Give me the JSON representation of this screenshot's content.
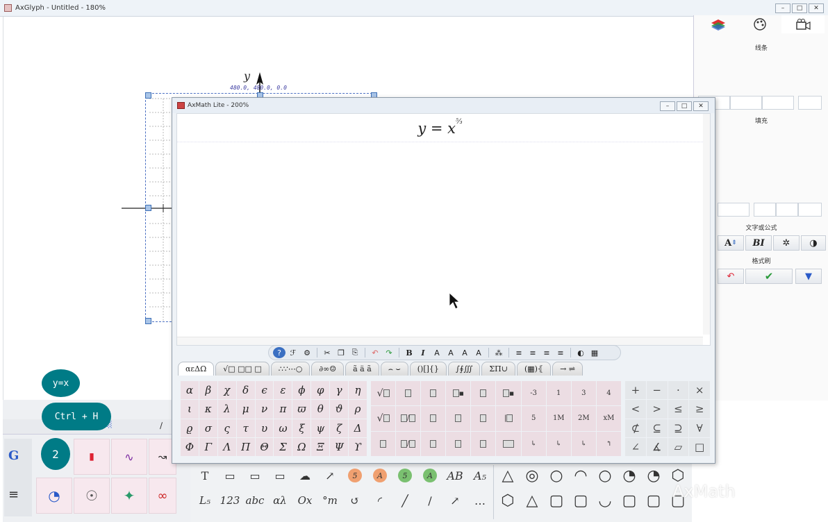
{
  "main_window": {
    "title": "AxGlyph - Untitled - 180%",
    "min": "–",
    "max": "□",
    "close": "✕"
  },
  "canvas": {
    "axis_label": "y",
    "coord_readout": "480.0, 480.0, 0.0"
  },
  "right_panel": {
    "line_label": "线条",
    "fill_label": "填充",
    "text_formula_label": "文字或公式",
    "format_brush_label": "格式刷",
    "bold_italic": "BI",
    "text_style_icon": "A"
  },
  "axmath": {
    "title": "AxMath Lite - 200%",
    "formula": "y = x",
    "formula_sup": "⁵⁄₃",
    "toolbar": [
      "?",
      "ℱ",
      "⚙",
      "✂",
      "❐",
      "⎘",
      "↶",
      "↷",
      "B",
      "I",
      "A",
      "A",
      "A",
      "A",
      "⁂",
      "≡",
      "≡",
      "≡",
      "≡",
      "◐",
      "▦"
    ],
    "tabs": [
      "αεΔΩ",
      "√□ □□ □",
      "∴∵⋯○",
      "∂∞☺",
      "ã ä ã",
      "⌢ ⌣",
      "()[]{}",
      "∫∮∭",
      "ΣΠ∪",
      "(▦)⦃",
      "→ ⇌"
    ],
    "greek": [
      "α",
      "β",
      "χ",
      "δ",
      "ϵ",
      "ε",
      "ϕ",
      "φ",
      "γ",
      "η",
      "ι",
      "κ",
      "λ",
      "μ",
      "ν",
      "π",
      "ϖ",
      "θ",
      "ϑ",
      "ρ",
      "ϱ",
      "σ",
      "ς",
      "τ",
      "υ",
      "ω",
      "ξ",
      "ψ",
      "ζ",
      "Δ",
      "Φ",
      "Γ",
      "Λ",
      "Π",
      "Θ",
      "Σ",
      "Ω",
      "Ξ",
      "Ψ",
      "ϒ"
    ],
    "templates_text": [
      "-3",
      "1",
      "3",
      "4",
      "5",
      "1M",
      "2M",
      "xM"
    ],
    "relations": [
      "+",
      "−",
      "·",
      "×",
      "<",
      ">",
      "≤",
      "≥",
      "⊄",
      "⊆",
      "⊇",
      "∀",
      "∠",
      "∡",
      "▱",
      "□"
    ]
  },
  "bubbles": {
    "b1": "y=x",
    "b2": "Ctrl + H",
    "b3": "2"
  },
  "bottom_tools": {
    "row1": [
      "T",
      "▭",
      "▭",
      "▭",
      "☁",
      "↗",
      "5",
      "A",
      "5",
      "A",
      "AB",
      "A₅"
    ],
    "row2": [
      "L₅",
      "123",
      "abc",
      "αλ",
      "Ox",
      "°m",
      "↺",
      "◜",
      "╱",
      "∕",
      "↗",
      "…"
    ],
    "shapes_row1": [
      "△",
      "◎",
      "○",
      "◠",
      "○",
      "◔",
      "◔",
      "⬡"
    ],
    "shapes_row2": [
      "⬡",
      "△",
      "▢",
      "▢",
      "◡",
      "▢",
      "▢",
      "▢"
    ]
  },
  "watermark": "AxMath"
}
